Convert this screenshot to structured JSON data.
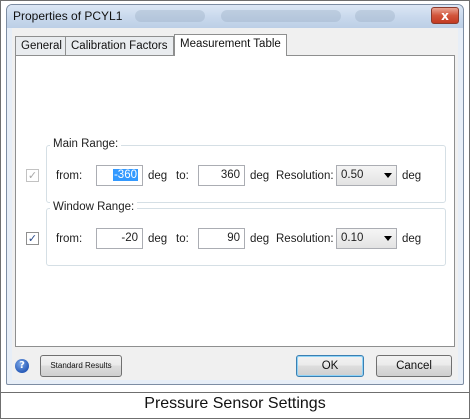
{
  "window": {
    "title": "Properties of PCYL1",
    "close_glyph": "x"
  },
  "tabs": [
    {
      "label": "General"
    },
    {
      "label": "Calibration Factors"
    },
    {
      "label": "Measurement Table"
    }
  ],
  "active_tab": "Measurement Table",
  "main_range": {
    "label": "Main Range:",
    "enabled": false,
    "checkbox_glyph": "✓",
    "from_label": "from:",
    "from_value": "-360",
    "from_unit": "deg",
    "to_label": "to:",
    "to_value": "360",
    "to_unit": "deg",
    "resolution_label": "Resolution:",
    "resolution_value": "0.50",
    "resolution_unit": "deg"
  },
  "window_range": {
    "label": "Window Range:",
    "enabled": true,
    "checkbox_glyph": "✓",
    "from_label": "from:",
    "from_value": "-20",
    "from_unit": "deg",
    "to_label": "to:",
    "to_value": "90",
    "to_unit": "deg",
    "resolution_label": "Resolution:",
    "resolution_value": "0.10",
    "resolution_unit": "deg"
  },
  "footer": {
    "help_glyph": "?",
    "standard_results_label": "Standard Results",
    "ok_label": "OK",
    "cancel_label": "Cancel"
  },
  "caption": "Pressure Sensor Settings",
  "colors": {
    "selection": "#3399ff",
    "close_button": "#d2553b",
    "titlebar": "#c8d8ec"
  },
  "icons": {
    "close": "close-icon",
    "help": "help-icon",
    "dropdown": "chevron-down-icon"
  }
}
